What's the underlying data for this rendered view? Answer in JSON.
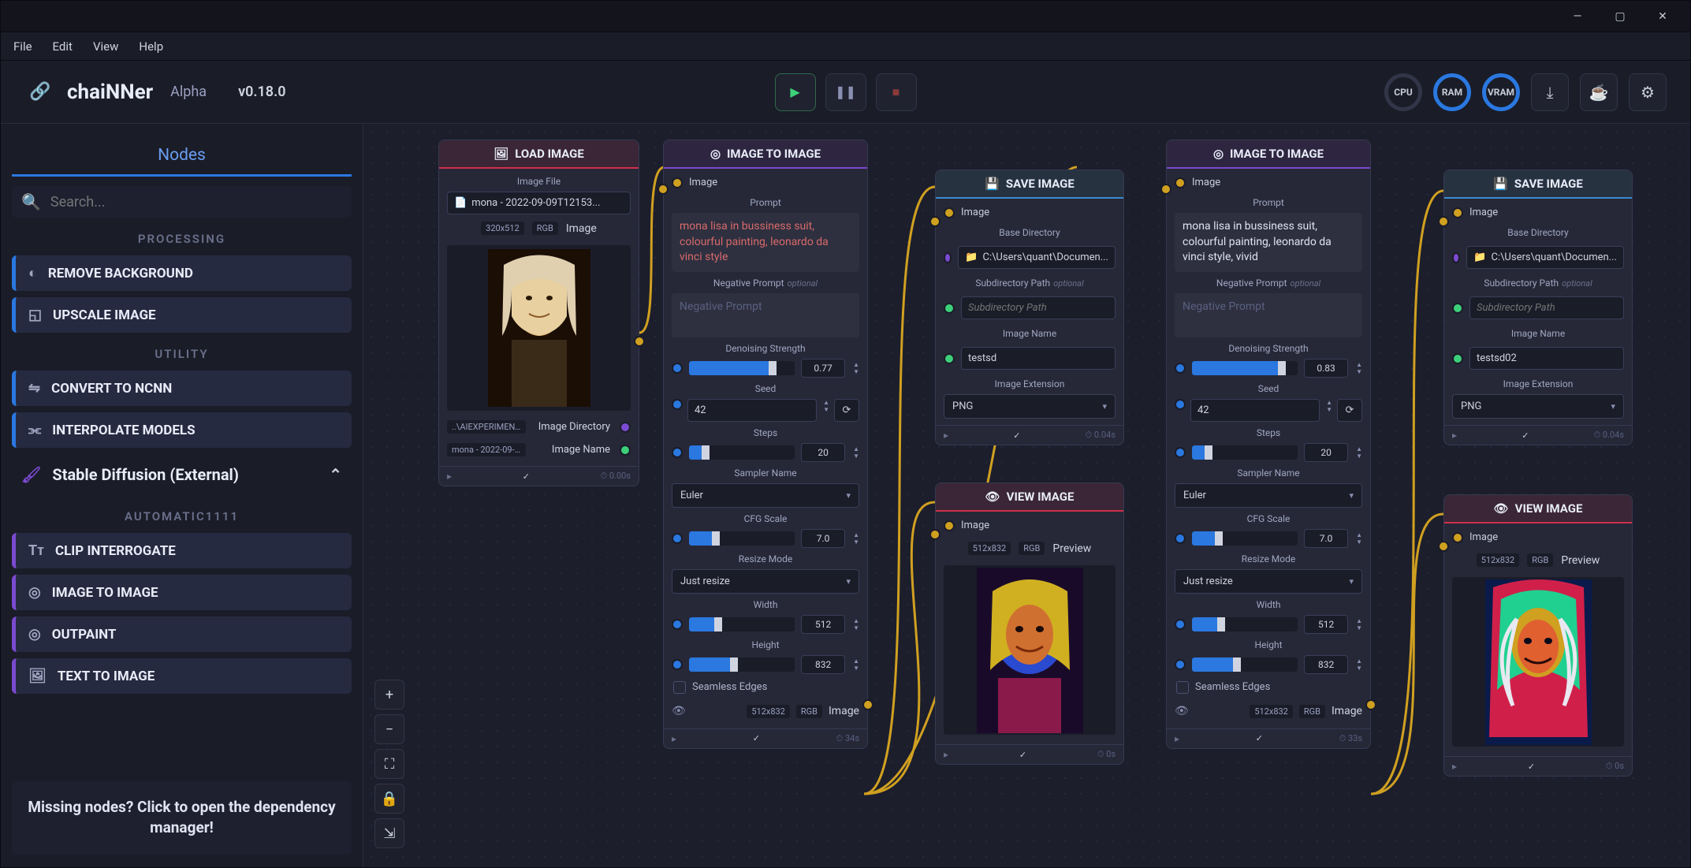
{
  "window": {
    "minimize": "—",
    "maximize": "▢",
    "close": "✕"
  },
  "menubar": [
    "File",
    "Edit",
    "View",
    "Help"
  ],
  "app": {
    "name": "chaiNNer",
    "badge": "Alpha",
    "version": "v0.18.0"
  },
  "playback": {
    "play": "▶",
    "pause": "❚❚",
    "stop": "■"
  },
  "status_rings": [
    {
      "label": "CPU",
      "active": false
    },
    {
      "label": "RAM",
      "active": true
    },
    {
      "label": "VRAM",
      "active": true
    }
  ],
  "toolbar_icons": {
    "download": "⤓",
    "coffee": "☕",
    "settings": "⚙"
  },
  "sidebar": {
    "tab": "Nodes",
    "search_placeholder": "Search...",
    "cat_processing": "PROCESSING",
    "cat_utility": "UTILITY",
    "cat_auto": "AUTOMATIC1111",
    "nodes_proc": [
      "REMOVE BACKGROUND",
      "UPSCALE IMAGE"
    ],
    "nodes_util": [
      "CONVERT TO NCNN",
      "INTERPOLATE MODELS"
    ],
    "cat_sd": "Stable Diffusion (External)",
    "nodes_sd": [
      "CLIP INTERROGATE",
      "IMAGE TO IMAGE",
      "OUTPAINT",
      "TEXT TO IMAGE"
    ],
    "dep_msg": "Missing nodes? Click to open the dependency manager!"
  },
  "canvas_ctrl": {
    "plus": "+",
    "minus": "−",
    "fit": "⛶",
    "lock": "🔒",
    "export": "⇲"
  },
  "nodes": {
    "load": {
      "title": "LOAD IMAGE",
      "file_lbl": "Image File",
      "file_val": "mona - 2022-09-09T12153...",
      "dims": "320x512",
      "mode": "RGB",
      "type": "Image",
      "dir_lbl": "Image Directory",
      "dir_val": "..\\AIEXPERIMENTE",
      "name_lbl": "Image Name",
      "name_val": "mona - 2022-09-0...",
      "time": "0.00s"
    },
    "i2i": {
      "title": "IMAGE TO IMAGE",
      "in_image": "Image",
      "prompt_lbl": "Prompt",
      "neg_lbl": "Negative Prompt",
      "optional": "optional",
      "neg_ph": "Negative Prompt",
      "denoise_lbl": "Denoising Strength",
      "seed_lbl": "Seed",
      "seed_val": "42",
      "steps_lbl": "Steps",
      "steps_val": "20",
      "sampler_lbl": "Sampler Name",
      "sampler_val": "Euler",
      "cfg_lbl": "CFG Scale",
      "cfg_val": "7.0",
      "resize_lbl": "Resize Mode",
      "resize_val": "Just resize",
      "width_lbl": "Width",
      "width_val": "512",
      "height_lbl": "Height",
      "height_val": "832",
      "seamless_lbl": "Seamless Edges",
      "out_dims": "512x832",
      "out_mode": "RGB",
      "out_lbl": "Image"
    },
    "i2i1": {
      "prompt": "mona lisa in bussiness suit, colourful painting, leonardo da vinci style",
      "denoise": "0.77",
      "time": "34s"
    },
    "i2i2": {
      "prompt": "mona lisa in bussiness suit, colourful painting, leonardo da vinci style, vivid",
      "denoise": "0.83",
      "time": "33s"
    },
    "save": {
      "title": "SAVE IMAGE",
      "in_image": "Image",
      "dir_lbl": "Base Directory",
      "dir_val": "C:\\Users\\quant\\Documen...",
      "sub_lbl": "Subdirectory Path",
      "optional": "optional",
      "sub_ph": "Subdirectory Path",
      "name_lbl": "Image Name",
      "ext_lbl": "Image Extension",
      "ext_val": "PNG",
      "time": "0.04s"
    },
    "save1": {
      "name": "testsd"
    },
    "save2": {
      "name": "testsd02"
    },
    "view": {
      "title": "VIEW IMAGE",
      "in_image": "Image",
      "dims": "512x832",
      "mode": "RGB",
      "type": "Preview",
      "time": "0s"
    }
  }
}
